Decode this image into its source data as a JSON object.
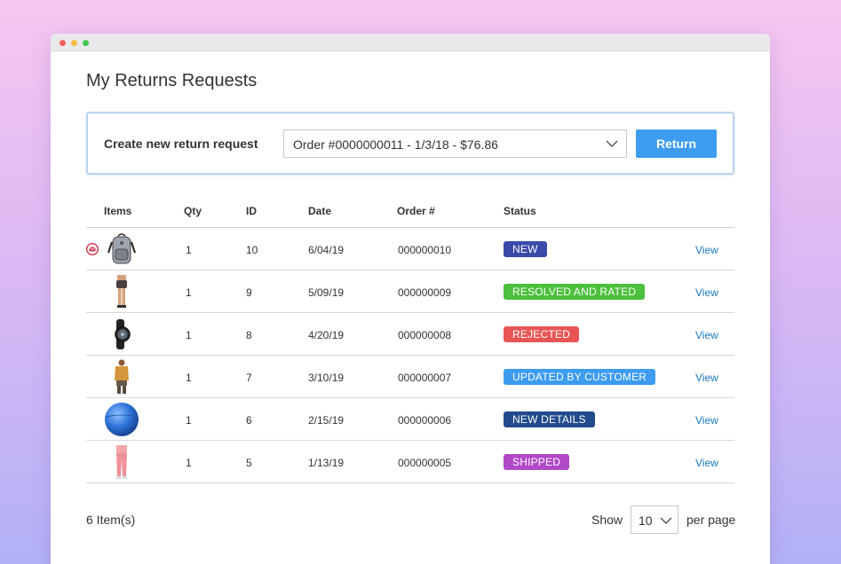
{
  "page": {
    "title": "My Returns Requests"
  },
  "create": {
    "label": "Create new return request",
    "selected_order": "Order #0000000011 - 1/3/18 - $76.86",
    "button_label": "Return"
  },
  "table": {
    "headers": {
      "items": "Items",
      "qty": "Qty",
      "id": "ID",
      "date": "Date",
      "order": "Order #",
      "status": "Status"
    },
    "rows": [
      {
        "item_icon": "backpack-icon",
        "has_message": true,
        "qty": "1",
        "id": "10",
        "date": "6/04/19",
        "order": "000000010",
        "status": "NEW",
        "status_color": "#3a4aa8",
        "action": "View"
      },
      {
        "item_icon": "shorts-model-icon",
        "has_message": false,
        "qty": "1",
        "id": "9",
        "date": "5/09/19",
        "order": "000000009",
        "status": "RESOLVED AND RATED",
        "status_color": "#4cbf3c",
        "action": "View"
      },
      {
        "item_icon": "fitness-watch-icon",
        "has_message": false,
        "qty": "1",
        "id": "8",
        "date": "4/20/19",
        "order": "000000008",
        "status": "REJECTED",
        "status_color": "#e85555",
        "action": "View"
      },
      {
        "item_icon": "top-model-icon",
        "has_message": false,
        "qty": "1",
        "id": "7",
        "date": "3/10/19",
        "order": "000000007",
        "status": "UPDATED BY CUSTOMER",
        "status_color": "#3d9bf0",
        "action": "View"
      },
      {
        "item_icon": "exercise-ball-icon",
        "has_message": false,
        "qty": "1",
        "id": "6",
        "date": "2/15/19",
        "order": "000000006",
        "status": "NEW DETAILS",
        "status_color": "#224a8c",
        "action": "View"
      },
      {
        "item_icon": "pants-model-icon",
        "has_message": false,
        "qty": "1",
        "id": "5",
        "date": "1/13/19",
        "order": "000000005",
        "status": "SHIPPED",
        "status_color": "#b048c8",
        "action": "View"
      }
    ]
  },
  "footer": {
    "count": "6 Item(s)",
    "show_label": "Show",
    "per_page_value": "10",
    "per_page_label": "per page"
  }
}
